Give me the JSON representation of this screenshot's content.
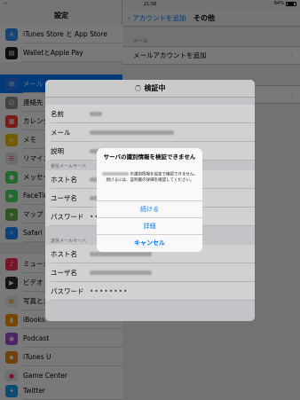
{
  "status": {
    "time": "21:58",
    "battery": "64%"
  },
  "sidebar": {
    "title": "設定",
    "items": [
      {
        "label": "iTunes Store と App Store",
        "icon": "app-store-icon",
        "color": "#2e8ef5",
        "glyph": "A"
      },
      {
        "label": "WalletとApple Pay",
        "icon": "wallet-icon",
        "color": "#1c1c1e",
        "glyph": "▤"
      },
      {
        "label": "メール",
        "icon": "mail-icon",
        "color": "#2d7cf6",
        "glyph": "✉"
      },
      {
        "label": "連絡先",
        "icon": "contacts-icon",
        "color": "#8e8e93",
        "glyph": "☺"
      },
      {
        "label": "カレンダー",
        "icon": "calendar-icon",
        "color": "#ff3b30",
        "glyph": "▦"
      },
      {
        "label": "メモ",
        "icon": "notes-icon",
        "color": "#f5c400",
        "glyph": "≡"
      },
      {
        "label": "リマインダー",
        "icon": "reminders-icon",
        "color": "#f2f2f2",
        "glyph": "☰"
      },
      {
        "label": "メッセージ",
        "icon": "messages-icon",
        "color": "#4cd964",
        "glyph": "●"
      },
      {
        "label": "FaceTime",
        "icon": "facetime-icon",
        "color": "#4cd964",
        "glyph": "▶"
      },
      {
        "label": "マップ",
        "icon": "maps-icon",
        "color": "#69b34c",
        "glyph": "➤"
      },
      {
        "label": "Safari",
        "icon": "safari-icon",
        "color": "#1a8cff",
        "glyph": "✧"
      },
      {
        "label": "ミュージック",
        "icon": "music-icon",
        "color": "#ff2d55",
        "glyph": "♪"
      },
      {
        "label": "ビデオ",
        "icon": "video-icon",
        "color": "#2d2d2d",
        "glyph": "▶"
      },
      {
        "label": "写真とカメラ",
        "icon": "photos-icon",
        "color": "#f0f0f0",
        "glyph": "✿"
      },
      {
        "label": "iBooks",
        "icon": "ibooks-icon",
        "color": "#ff9500",
        "glyph": "▮"
      },
      {
        "label": "Podcast",
        "icon": "podcast-icon",
        "color": "#a64cd9",
        "glyph": "◉"
      },
      {
        "label": "iTunes U",
        "icon": "itunes-u-icon",
        "color": "#f28c1e",
        "glyph": "◆"
      },
      {
        "label": "Game Center",
        "icon": "game-center-icon",
        "color": "#e8e8e8",
        "glyph": "●"
      },
      {
        "label": "Twitter",
        "icon": "twitter-icon",
        "color": "#1da1f2",
        "glyph": "✦"
      }
    ]
  },
  "detail": {
    "back_label": "アカウントを追加",
    "title": "その他",
    "section_header": "メール",
    "row_label": "メールアカウントを追加"
  },
  "sheet": {
    "title": "検証中",
    "name_label": "名前",
    "email_label": "メール",
    "desc_label": "説明",
    "incoming_header": "受信メールサーバ",
    "outgoing_header": "送信メールサーバ",
    "host_label": "ホスト名",
    "user_label": "ユーザ名",
    "password_label": "パスワード",
    "password_value": "••••••••"
  },
  "alert": {
    "title": "サーバの識別情報を検証できません",
    "message_a": "の識別情報を設定で確認できません。続けるには、証明書の詳細を確認してください。",
    "buttons": {
      "continue": "続ける",
      "details": "詳細",
      "cancel": "キャンセル"
    }
  }
}
